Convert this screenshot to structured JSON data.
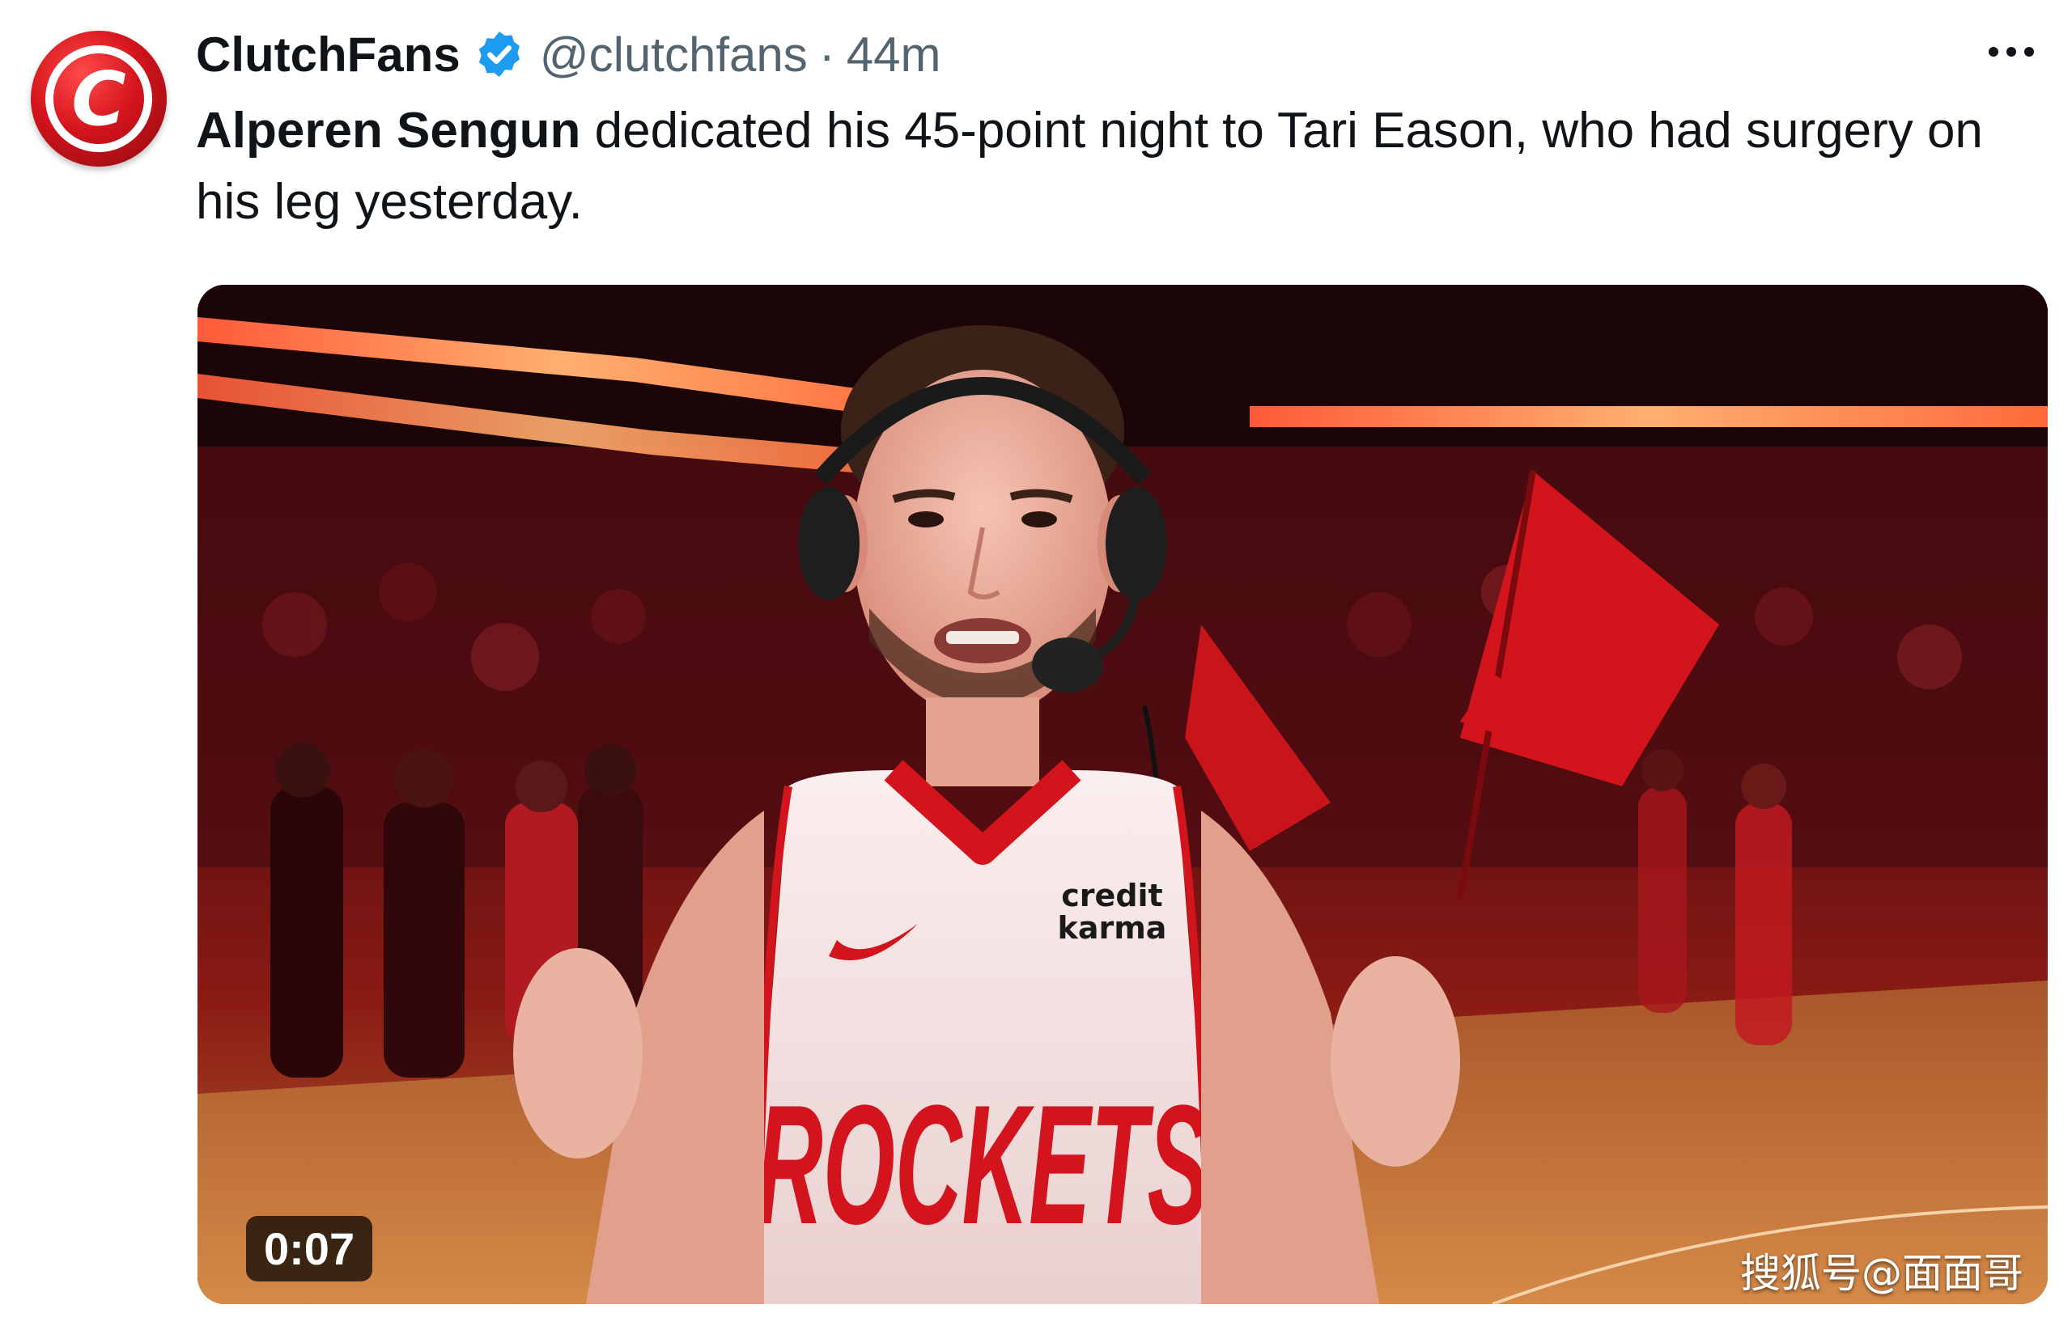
{
  "post": {
    "author": {
      "display_name": "ClutchFans",
      "handle": "@clutchfans",
      "verified": true,
      "avatar_icon": "clutchfans-logo-icon"
    },
    "separator": "·",
    "time_ago": "44m",
    "more_icon": "more-dots-icon",
    "text": {
      "mention": "Alperen Sengun",
      "body": " dedicated his 45-point night to Tari Eason, who had surgery on his leg yesterday."
    },
    "video": {
      "timestamp": "0:07",
      "jersey_wordmark": "ROCKETS",
      "sponsor_patch": [
        "credit",
        "karma"
      ]
    },
    "watermark": "搜狐号@面面哥"
  },
  "colors": {
    "accent_red": "#d4141c",
    "verified_blue": "#1d9bf0",
    "text_primary": "#0f1419",
    "text_secondary": "#536471"
  }
}
